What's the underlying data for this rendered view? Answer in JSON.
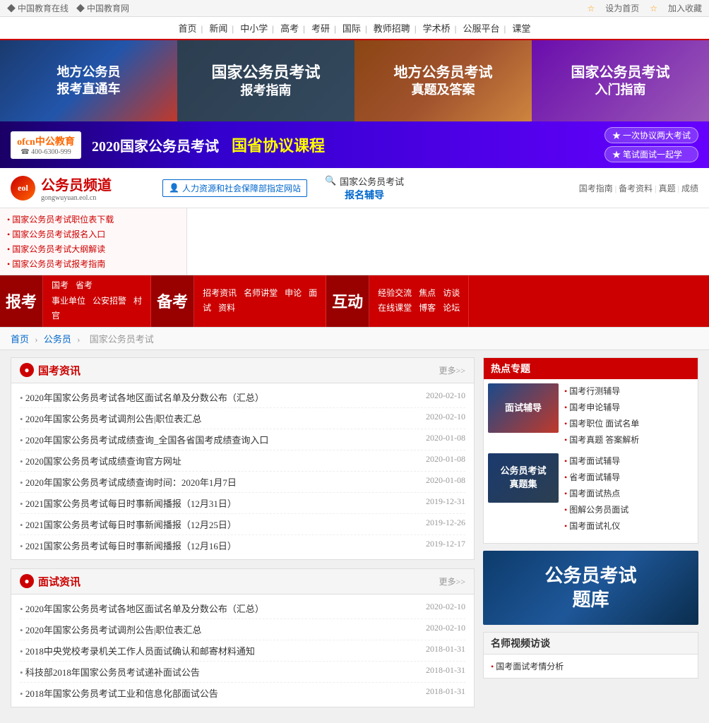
{
  "topbar": {
    "left": [
      "中国教育在线",
      "中国教育网"
    ],
    "right": [
      "设为首页",
      "加入收藏"
    ]
  },
  "navbar": {
    "items": [
      "首页",
      "新闻",
      "中小学",
      "高考",
      "考研",
      "国际",
      "教师招聘",
      "学术桥",
      "公服平台",
      "课堂"
    ]
  },
  "banners": [
    {
      "line1": "地方公务员",
      "line2": "报考直通车",
      "class": "b1"
    },
    {
      "line1": "国家公务员考试",
      "line2": "报考指南",
      "class": "b2"
    },
    {
      "line1": "地方公务员考试",
      "line2": "真题及答案",
      "class": "b3"
    },
    {
      "line1": "国家公务员考试",
      "line2": "入门指南",
      "class": "b4"
    }
  ],
  "ad": {
    "logo": "ofcn中公教育",
    "phone": "☎ 400-6300-999",
    "title": "2020国家公务员考试",
    "highlight": "国省协议课程",
    "tag1": "★ 一次协议两大考试",
    "tag2": "★ 笔试面试一起学"
  },
  "sidebar_links": [
    "国家公务员考试职位表下载",
    "国家公务员考试报名入口",
    "国家公务员考试大纲解读",
    "国家公务员考试报考指南"
  ],
  "logo_section": {
    "name": "公务员频道",
    "sub": "gongwuyuan.eol.cn",
    "auth_label": "人力资源和社会保障部指定网站"
  },
  "search": {
    "label": "国家公务员考试",
    "link": "报名辅导",
    "placeholder": "搜索"
  },
  "right_nav_links": [
    "国考指南",
    "备考资料",
    "真题",
    "成绩"
  ],
  "full_nav": {
    "sections": [
      {
        "label": "报考",
        "items_row1": [
          "国考",
          "省考"
        ],
        "items_row2": [
          "事业单位",
          "公安招警",
          "村官"
        ]
      },
      {
        "label": "备考",
        "items_row1": [
          "招考资讯",
          "名师讲堂",
          "申论",
          "面试"
        ],
        "items_row2": [
          "资料"
        ]
      },
      {
        "label": "互动",
        "items_row1": [
          "经验交流",
          "焦点",
          "访谈"
        ],
        "items_row2": [
          "在线课堂",
          "博客",
          "论坛"
        ]
      }
    ]
  },
  "breadcrumb": {
    "items": [
      "首页",
      "公务员",
      "国家公务员考试"
    ]
  },
  "guokao_news": {
    "title": "国考资讯",
    "more": "更多>>",
    "items": [
      {
        "text": "2020年国家公务员考试各地区面试名单及分数公布（汇总）",
        "date": "2020-02-10"
      },
      {
        "text": "2020年国家公务员考试调剂公告|职位表汇总",
        "date": "2020-02-10"
      },
      {
        "text": "2020年国家公务员考试成绩查询_全国各省国考成绩查询入口",
        "date": "2020-01-08"
      },
      {
        "text": "2020国家公务员考试成绩查询官方网址",
        "date": "2020-01-08"
      },
      {
        "text": "2020年国家公务员考试成绩查询时间：2020年1月7日",
        "date": "2020-01-08"
      },
      {
        "text": "2021国家公务员考试每日时事新闻播报（12月31日）",
        "date": "2019-12-31"
      },
      {
        "text": "2021国家公务员考试每日时事新闻播报（12月25日）",
        "date": "2019-12-26"
      },
      {
        "text": "2021国家公务员考试每日时事新闻播报（12月16日）",
        "date": "2019-12-17"
      }
    ]
  },
  "mianshi_news": {
    "title": "面试资讯",
    "more": "更多>>",
    "items": [
      {
        "text": "2020年国家公务员考试各地区面试名单及分数公布（汇总）",
        "date": "2020-02-10"
      },
      {
        "text": "2020年国家公务员考试调剂公告|职位表汇总",
        "date": "2020-02-10"
      },
      {
        "text": "2018中央党校考录机关工作人员面试确认和邮寄材料通知",
        "date": "2018-01-31"
      },
      {
        "text": "科技部2018年国家公务员考试递补面试公告",
        "date": "2018-01-31"
      },
      {
        "text": "2018年国家公务员考试工业和信息化部面试公告",
        "date": "2018-01-31"
      }
    ]
  },
  "hot_topics": {
    "title": "热点专题",
    "thumb1_text": "面试辅导",
    "thumb2_text": "公务员考试\n真题集",
    "links1": [
      "国考行测辅导",
      "国考申论辅导",
      "国考职位 面试名单",
      "国考真题 答案解析"
    ],
    "links2": [
      "国考面试辅导",
      "省考面试辅导",
      "国考面试热点",
      "图解公务员面试",
      "国考面试礼仪"
    ]
  },
  "qbank": {
    "line1": "公务员考试",
    "line2": "题库"
  },
  "video_section": {
    "title": "名师视频访谈",
    "items": [
      "国考面试考情分析"
    ]
  }
}
